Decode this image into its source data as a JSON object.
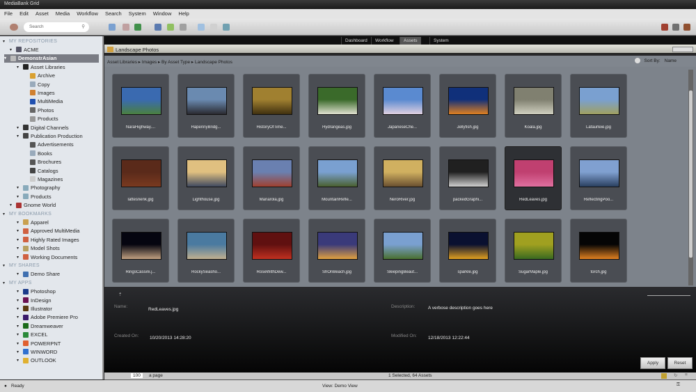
{
  "window": {
    "title": "MediaBank Grid"
  },
  "menu": [
    "File",
    "Edit",
    "Asset",
    "Media",
    "Workflow",
    "Search",
    "System",
    "Window",
    "Help"
  ],
  "toolbar": {
    "search_placeholder": "Search"
  },
  "sidebar": {
    "repositories_label": "MY REPOSITORIES",
    "items": [
      {
        "label": "ACME",
        "level": 1,
        "color": "#556"
      },
      {
        "label": "DemonstrAsian",
        "level": 1,
        "selected": true,
        "color": "#bbb"
      },
      {
        "label": "Asset Libraries",
        "level": 2,
        "color": "#222"
      },
      {
        "label": "Archive",
        "level": 3,
        "color": "#d9a030"
      },
      {
        "label": "Copy",
        "level": 3,
        "color": "#9ab"
      },
      {
        "label": "Images",
        "level": 3,
        "color": "#d08030"
      },
      {
        "label": "MultiMedia",
        "level": 3,
        "color": "#2050b0"
      },
      {
        "label": "Photos",
        "level": 3,
        "color": "#666"
      },
      {
        "label": "Products",
        "level": 3,
        "color": "#999"
      },
      {
        "label": "Digital Channels",
        "level": 2,
        "color": "#333"
      },
      {
        "label": "Publication Production",
        "level": 2,
        "color": "#444"
      },
      {
        "label": "Advertisements",
        "level": 3,
        "color": "#555"
      },
      {
        "label": "Books",
        "level": 3,
        "color": "#9ab"
      },
      {
        "label": "Brochures",
        "level": 3,
        "color": "#555"
      },
      {
        "label": "Catalogs",
        "level": 3,
        "color": "#444"
      },
      {
        "label": "Magazines",
        "level": 3,
        "color": "#ccc"
      },
      {
        "label": "Photography",
        "level": 2,
        "color": "#8ab"
      },
      {
        "label": "Products",
        "level": 2,
        "color": "#8ab"
      },
      {
        "label": "Gnome World",
        "level": 1,
        "color": "#a33"
      }
    ],
    "bookmarks_label": "MY BOOKMARKS",
    "bookmarks": [
      {
        "label": "Apparel",
        "color": "#c9a050"
      },
      {
        "label": "Approved MultiMedia",
        "color": "#d06040"
      },
      {
        "label": "Highly Rated Images",
        "color": "#d06040"
      },
      {
        "label": "Model Shots",
        "color": "#b8a060"
      },
      {
        "label": "Working Documents",
        "color": "#d06040"
      }
    ],
    "shares_label": "MY SHARES",
    "shares": [
      {
        "label": "Demo Share",
        "color": "#4070b0"
      }
    ],
    "apps_label": "MY APPS",
    "apps": [
      {
        "label": "Photoshop",
        "color": "#1a3a8a"
      },
      {
        "label": "InDesign",
        "color": "#6a1050"
      },
      {
        "label": "Illustrator",
        "color": "#5a3a10"
      },
      {
        "label": "Adobe Premiere Pro",
        "color": "#3a1a6a"
      },
      {
        "label": "Dreamweaver",
        "color": "#1a6a1a"
      },
      {
        "label": "EXCEL",
        "color": "#2a8a3a"
      },
      {
        "label": "POWERPNT",
        "color": "#e06030"
      },
      {
        "label": "WINWORD",
        "color": "#3070d0"
      },
      {
        "label": "OUTLOOK",
        "color": "#e0b030"
      }
    ]
  },
  "tabs": [
    {
      "label": "Dashboard"
    },
    {
      "label": "Workflow"
    },
    {
      "label": "Assets",
      "active": true
    },
    {
      "label": "System"
    }
  ],
  "panel": {
    "title": "Landscape Photos"
  },
  "breadcrumb": "Asset Libraries ▸ Images ▸ By Asset Type ▸ Landscape Photos",
  "sort": {
    "label": "Sort By:",
    "value": "Name"
  },
  "assets": [
    {
      "name": "NaraHighway....",
      "c1": "#3a6ab0",
      "c2": "#4a8040"
    },
    {
      "name": "HapennyBridg...",
      "c1": "#6a8ab0",
      "c2": "#2a2a30"
    },
    {
      "name": "HistoryOfTime...",
      "c1": "#a08030",
      "c2": "#403010"
    },
    {
      "name": "Hydrangeas.jpg",
      "c1": "#3a6a2a",
      "c2": "#e0e0d0"
    },
    {
      "name": "JapaneseChe...",
      "c1": "#5a8ad0",
      "c2": "#e0d0e0"
    },
    {
      "name": "Jellyfish.jpg",
      "c1": "#10307a",
      "c2": "#e08020"
    },
    {
      "name": "Koala.jpg",
      "c1": "#808070",
      "c2": "#d0d0c0"
    },
    {
      "name": "Lafaurleie.jpg",
      "c1": "#7aa0d0",
      "c2": "#a0a060"
    },
    {
      "name": "lattesnenk.jpg",
      "c1": "#5a2a1a",
      "c2": "#7a3a20"
    },
    {
      "name": "Lighthouse.jpg",
      "c1": "#e0c080",
      "c2": "#404a60"
    },
    {
      "name": "Manarola.jpg",
      "c1": "#6a80b0",
      "c2": "#a04030"
    },
    {
      "name": "MountainRefle...",
      "c1": "#7aa0d0",
      "c2": "#4a6030"
    },
    {
      "name": "NeroRiver.jpg",
      "c1": "#d0b060",
      "c2": "#6a5030"
    },
    {
      "name": "packedGraphi...",
      "c1": "#202020",
      "c2": "#d0d0d0"
    },
    {
      "name": "RedLeaves.jpg",
      "c1": "#c04070",
      "c2": "#e070a0",
      "selected": true
    },
    {
      "name": "ReflectingPoo...",
      "c1": "#80a0d0",
      "c2": "#2a4060"
    },
    {
      "name": "RingsCassini.j...",
      "c1": "#050510",
      "c2": "#c0a080"
    },
    {
      "name": "RockySeasho...",
      "c1": "#4a7aa0",
      "c2": "#c0b090"
    },
    {
      "name": "RoseWithDew...",
      "c1": "#601010",
      "c2": "#c03020"
    },
    {
      "name": "ShOnBeach.jpg",
      "c1": "#3a3a7a",
      "c2": "#e0a040"
    },
    {
      "name": "SleepingBeaut...",
      "c1": "#7aa0d0",
      "c2": "#4a7030"
    },
    {
      "name": "sparkle.jpg",
      "c1": "#0a1030",
      "c2": "#e0a020"
    },
    {
      "name": "SugarMaple.jpg",
      "c1": "#a0a020",
      "c2": "#3a6a20"
    },
    {
      "name": "torch.jpg",
      "c1": "#050505",
      "c2": "#e08020"
    }
  ],
  "detail": {
    "name_label": "Name:",
    "name_value": "RedLeaves.jpg",
    "description_label": "Description:",
    "description_value": "A verbose description goes here",
    "created_label": "Created On:",
    "created_value": "10/20/2013 14:28:20",
    "modified_label": "Modified On:",
    "modified_value": "12/18/2013 12:22:44",
    "apply": "Apply",
    "reset": "Reset"
  },
  "pagebar": {
    "per_page": "100",
    "per_page_label": "a page",
    "selection": "1 Selected, 64 Assets"
  },
  "status": {
    "left": "Ready",
    "view": "View: Demo View"
  }
}
